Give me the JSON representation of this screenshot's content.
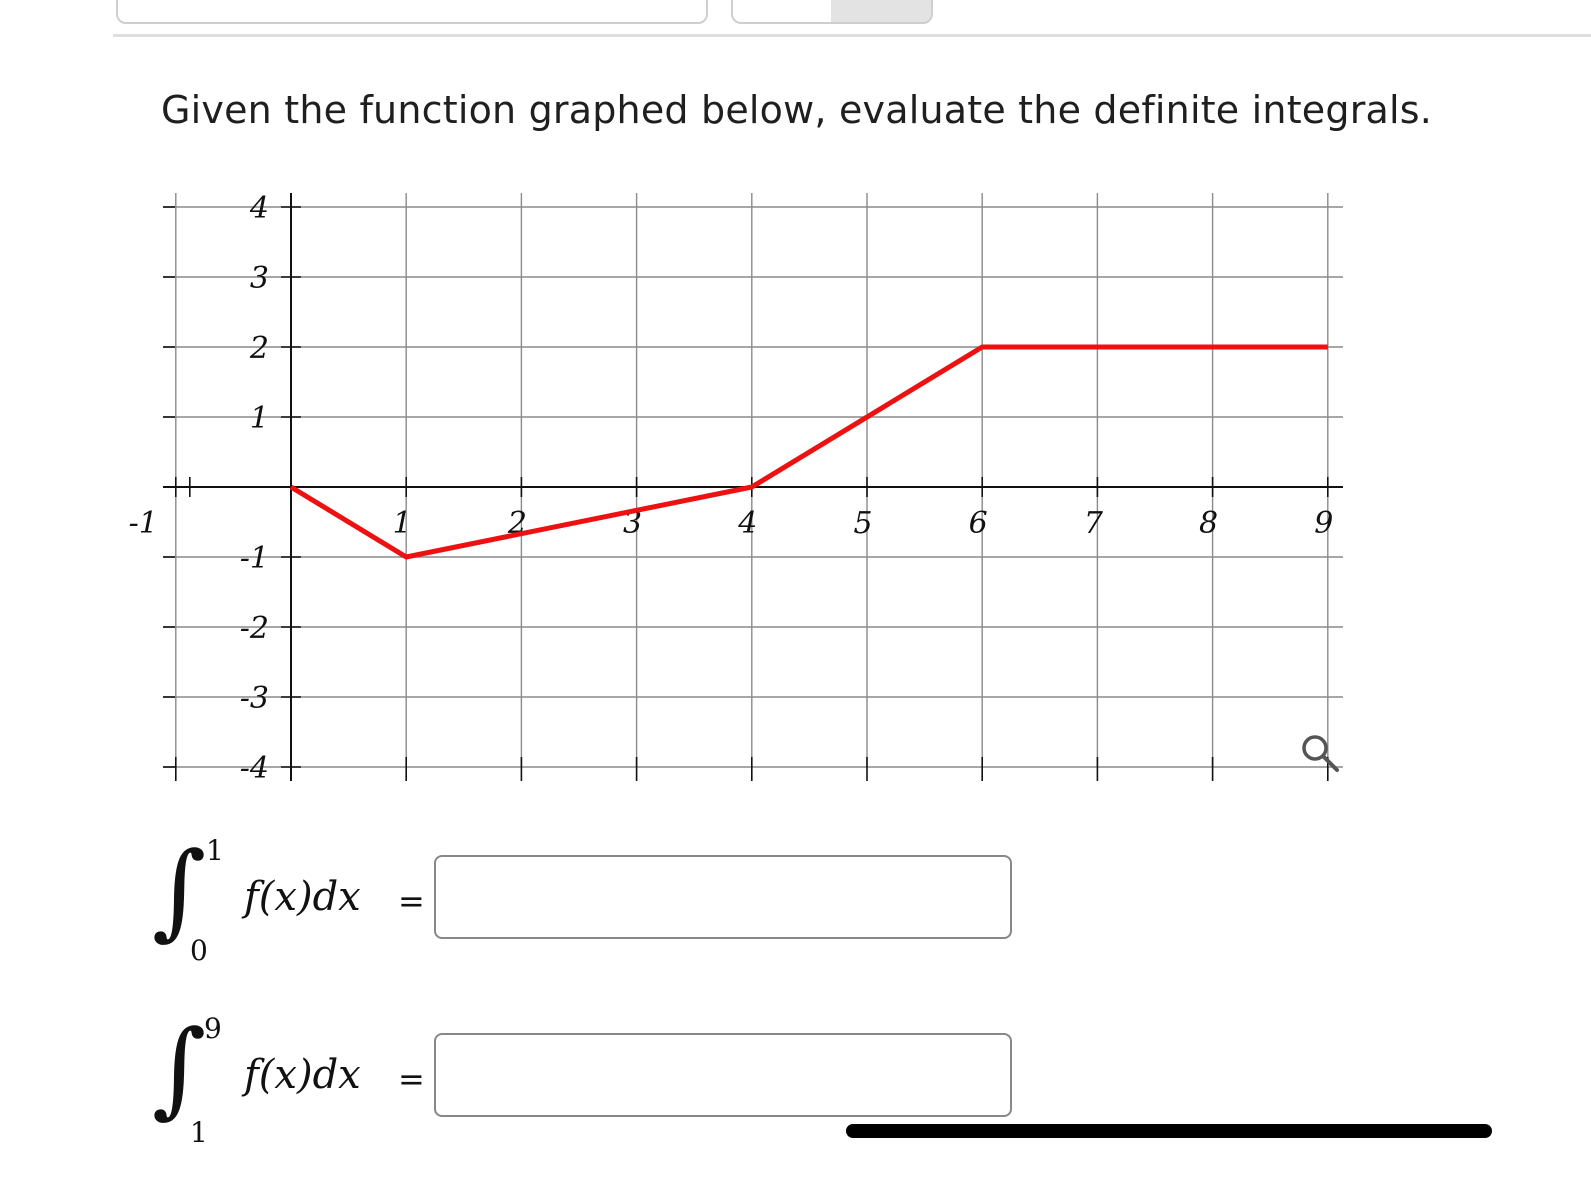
{
  "question": {
    "text": "Given the function graphed below, evaluate the definite integrals."
  },
  "chart_data": {
    "type": "line",
    "xlim": [
      -1,
      9
    ],
    "ylim": [
      -4,
      4
    ],
    "grid": true,
    "x_tick_labels": [
      "-1",
      "1",
      "2",
      "3",
      "4",
      "5",
      "6",
      "7",
      "8",
      "9"
    ],
    "y_tick_labels": [
      "4",
      "3",
      "2",
      "1",
      "-1",
      "-2",
      "-3",
      "-4"
    ],
    "series": [
      {
        "color": "#ee1111",
        "x": [
          0,
          1,
          4,
          6,
          9
        ],
        "y": [
          0,
          -1,
          0,
          2,
          2
        ]
      }
    ]
  },
  "integrals": [
    {
      "lower": "0",
      "upper": "1",
      "integrand": "f(x)dx",
      "equals": "=",
      "value": ""
    },
    {
      "lower": "1",
      "upper": "9",
      "integrand": "f(x)dx",
      "equals": "=",
      "value": ""
    }
  ],
  "icons": {
    "zoom": "magnifier-icon"
  }
}
